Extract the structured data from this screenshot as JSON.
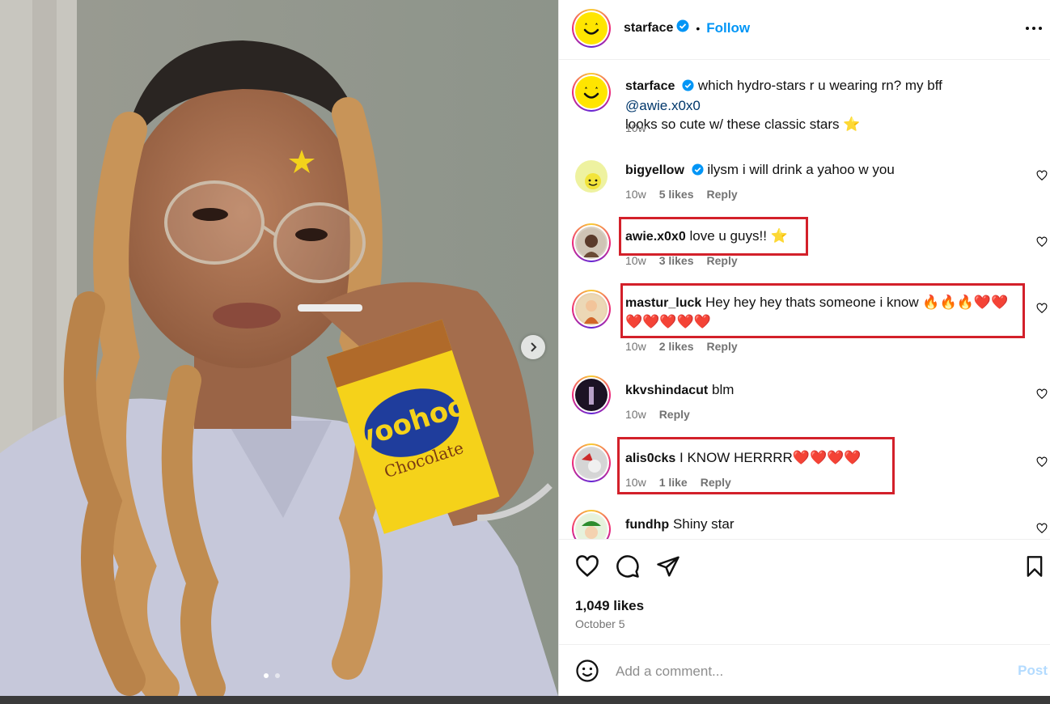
{
  "post": {
    "author": "starface",
    "follow_label": "Follow",
    "separator": "•",
    "caption": {
      "author": "starface",
      "text": "which hydro-stars r u wearing rn? my bff",
      "mention": "@awie.x0x0",
      "text2": "looks so cute w/ these classic stars",
      "emoji": "⭐",
      "time": "10w"
    },
    "likes": "1,049 likes",
    "date": "October 5"
  },
  "comments": [
    {
      "user": "bigyellow",
      "verified": true,
      "text": "ilysm i will drink a yahoo w you",
      "time": "10w",
      "likes": "5 likes",
      "reply": "Reply"
    },
    {
      "user": "awie.x0x0",
      "text": "love u guys!!",
      "emoji": "⭐",
      "time": "10w",
      "likes": "3 likes",
      "reply": "Reply"
    },
    {
      "user": "mastur_luck",
      "text": "Hey hey hey thats someone i know",
      "emoji_line1": "🔥🔥🔥❤️❤️",
      "emoji_line2": "❤️❤️❤️❤️❤️",
      "time": "10w",
      "likes": "2 likes",
      "reply": "Reply"
    },
    {
      "user": "kkvshindacut",
      "text": "blm",
      "time": "10w",
      "reply": "Reply"
    },
    {
      "user": "alis0cks",
      "text": "I KNOW HERRRR",
      "emoji": "❤️❤️❤️❤️",
      "time": "10w",
      "likes": "1 like",
      "reply": "Reply"
    },
    {
      "user": "fundhp",
      "text": "Shiny star"
    }
  ],
  "add_comment": {
    "placeholder": "Add a comment...",
    "post_label": "Post"
  },
  "icons": {
    "more": "more-options-icon",
    "heart": "heart-icon",
    "comment": "comment-icon",
    "share": "share-icon",
    "save": "bookmark-icon",
    "emoji": "emoji-icon",
    "next": "chevron-right-icon"
  },
  "colors": {
    "accent": "#0095f6",
    "highlight": "#d3202a",
    "avatar_yellow": "#ffe500"
  }
}
